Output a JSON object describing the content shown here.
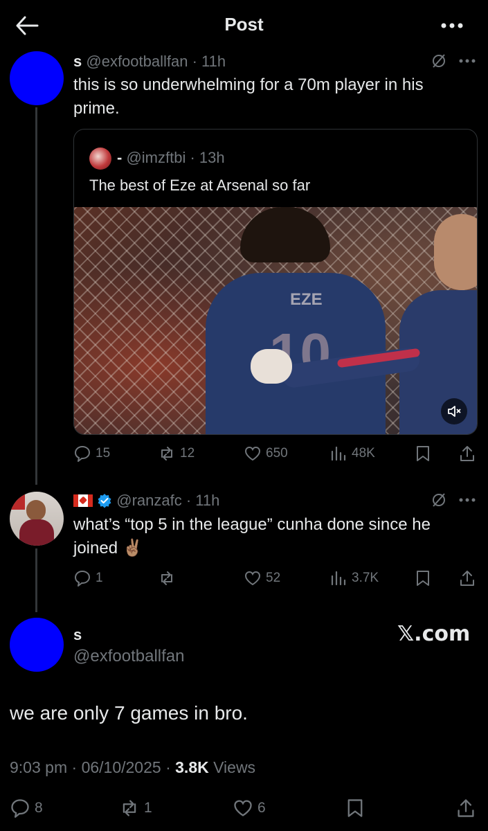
{
  "header": {
    "title": "Post"
  },
  "reply1": {
    "name": "s",
    "handle": "@exfootballfan",
    "time": "· 11h",
    "text": "this is so underwhelming for a 70m player in his prime.",
    "quote": {
      "name": "-",
      "handle": "@imzftbi",
      "time": "· 13h",
      "text": "The best of Eze at Arsenal so far",
      "video": {
        "jersey_name": "EZE",
        "jersey_number": "10"
      }
    },
    "actions": {
      "replies": "15",
      "reposts": "12",
      "likes": "650",
      "views": "48K"
    }
  },
  "reply2": {
    "flag": "Canada",
    "handle": "@ranzafc",
    "time": "· 11h",
    "text": "what’s “top 5 in the league” cunha done since he joined ✌🏽",
    "actions": {
      "replies": "1",
      "reposts": "",
      "likes": "52",
      "views": "3.7K"
    }
  },
  "main": {
    "name": "s",
    "handle": "@exfootballfan",
    "watermark": "𝕏.com",
    "text": "we are only 7 games in bro.",
    "time": "9:03 pm",
    "date": "06/10/2025",
    "views_count": "3.8K",
    "views_label": "Views",
    "actions": {
      "replies": "8",
      "reposts": "1",
      "likes": "6"
    }
  },
  "colors": {
    "background": "#000000",
    "text": "#e7e9ea",
    "muted": "#71767b",
    "verified": "#1d9bf0",
    "avatar": "#0000ff"
  }
}
